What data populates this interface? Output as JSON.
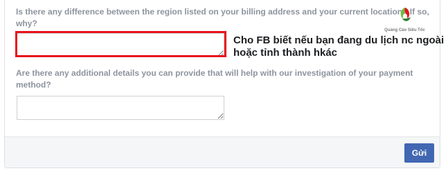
{
  "form": {
    "question_region": "Is there any difference between the region listed on your billing address and your current location? If so, why?",
    "question_details": "Are there any additional details you can provide that will help with our investigation of your payment method?",
    "region_answer_value": "",
    "details_answer_value": ""
  },
  "annotation": {
    "text": "Cho FB biết nếu bạn đang du lịch nc ngoài hoặc tỉnh thành hkác",
    "highlight_color": "#e8131c"
  },
  "footer": {
    "submit_label": "Gửi",
    "button_color": "#4267b2"
  },
  "logo": {
    "brand": "Quảng Cáo Siêu Tốc",
    "icon": "leaf-logo-icon"
  }
}
